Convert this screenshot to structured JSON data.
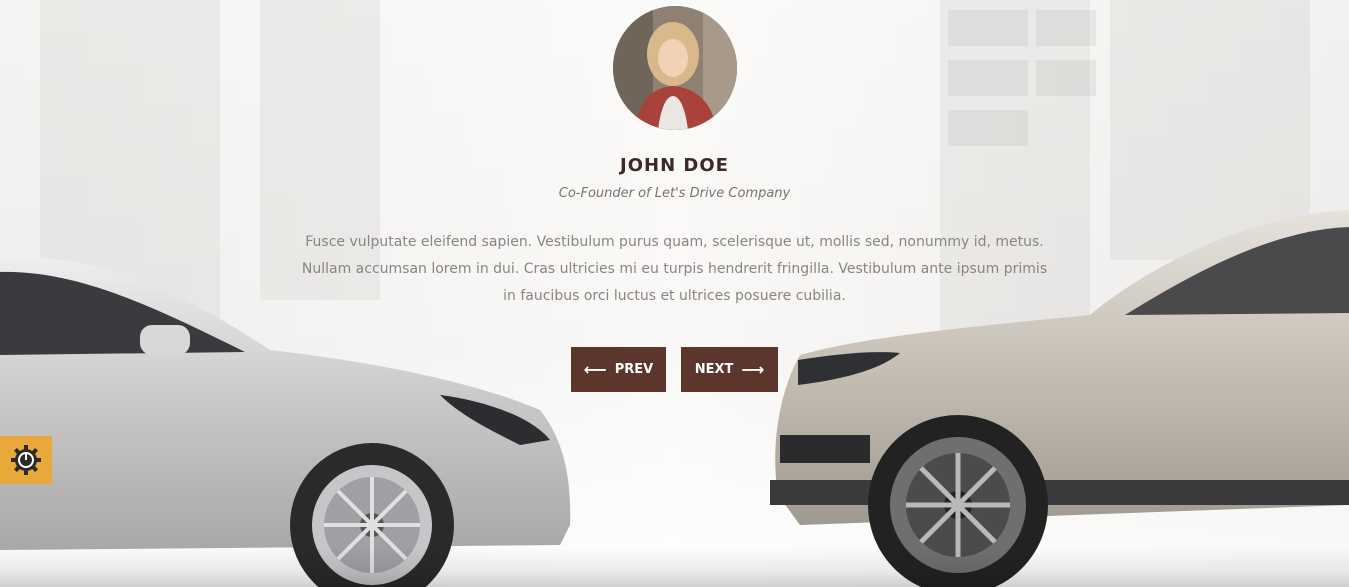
{
  "testimonial": {
    "name": "JOHN DOE",
    "role": "Co-Founder of Let's Drive Company",
    "quote": "Fusce vulputate eleifend sapien. Vestibulum purus quam, scelerisque ut, mollis sed, nonummy id, metus. Nullam accumsan lorem in dui. Cras ultricies mi eu turpis hendrerit fringilla. Vestibulum ante ipsum primis in faucibus orci luctus et ultrices posuere cubilia."
  },
  "nav": {
    "prev_label": "PREV",
    "next_label": "NEXT",
    "prev_arrow": "⟵",
    "next_arrow": "⟶"
  },
  "colors": {
    "button_bg": "#5c352c",
    "settings_bg": "#e9a83a",
    "name_text": "#3b2a26"
  },
  "icons": {
    "settings": "gear-power-icon",
    "avatar": "person-photo"
  }
}
